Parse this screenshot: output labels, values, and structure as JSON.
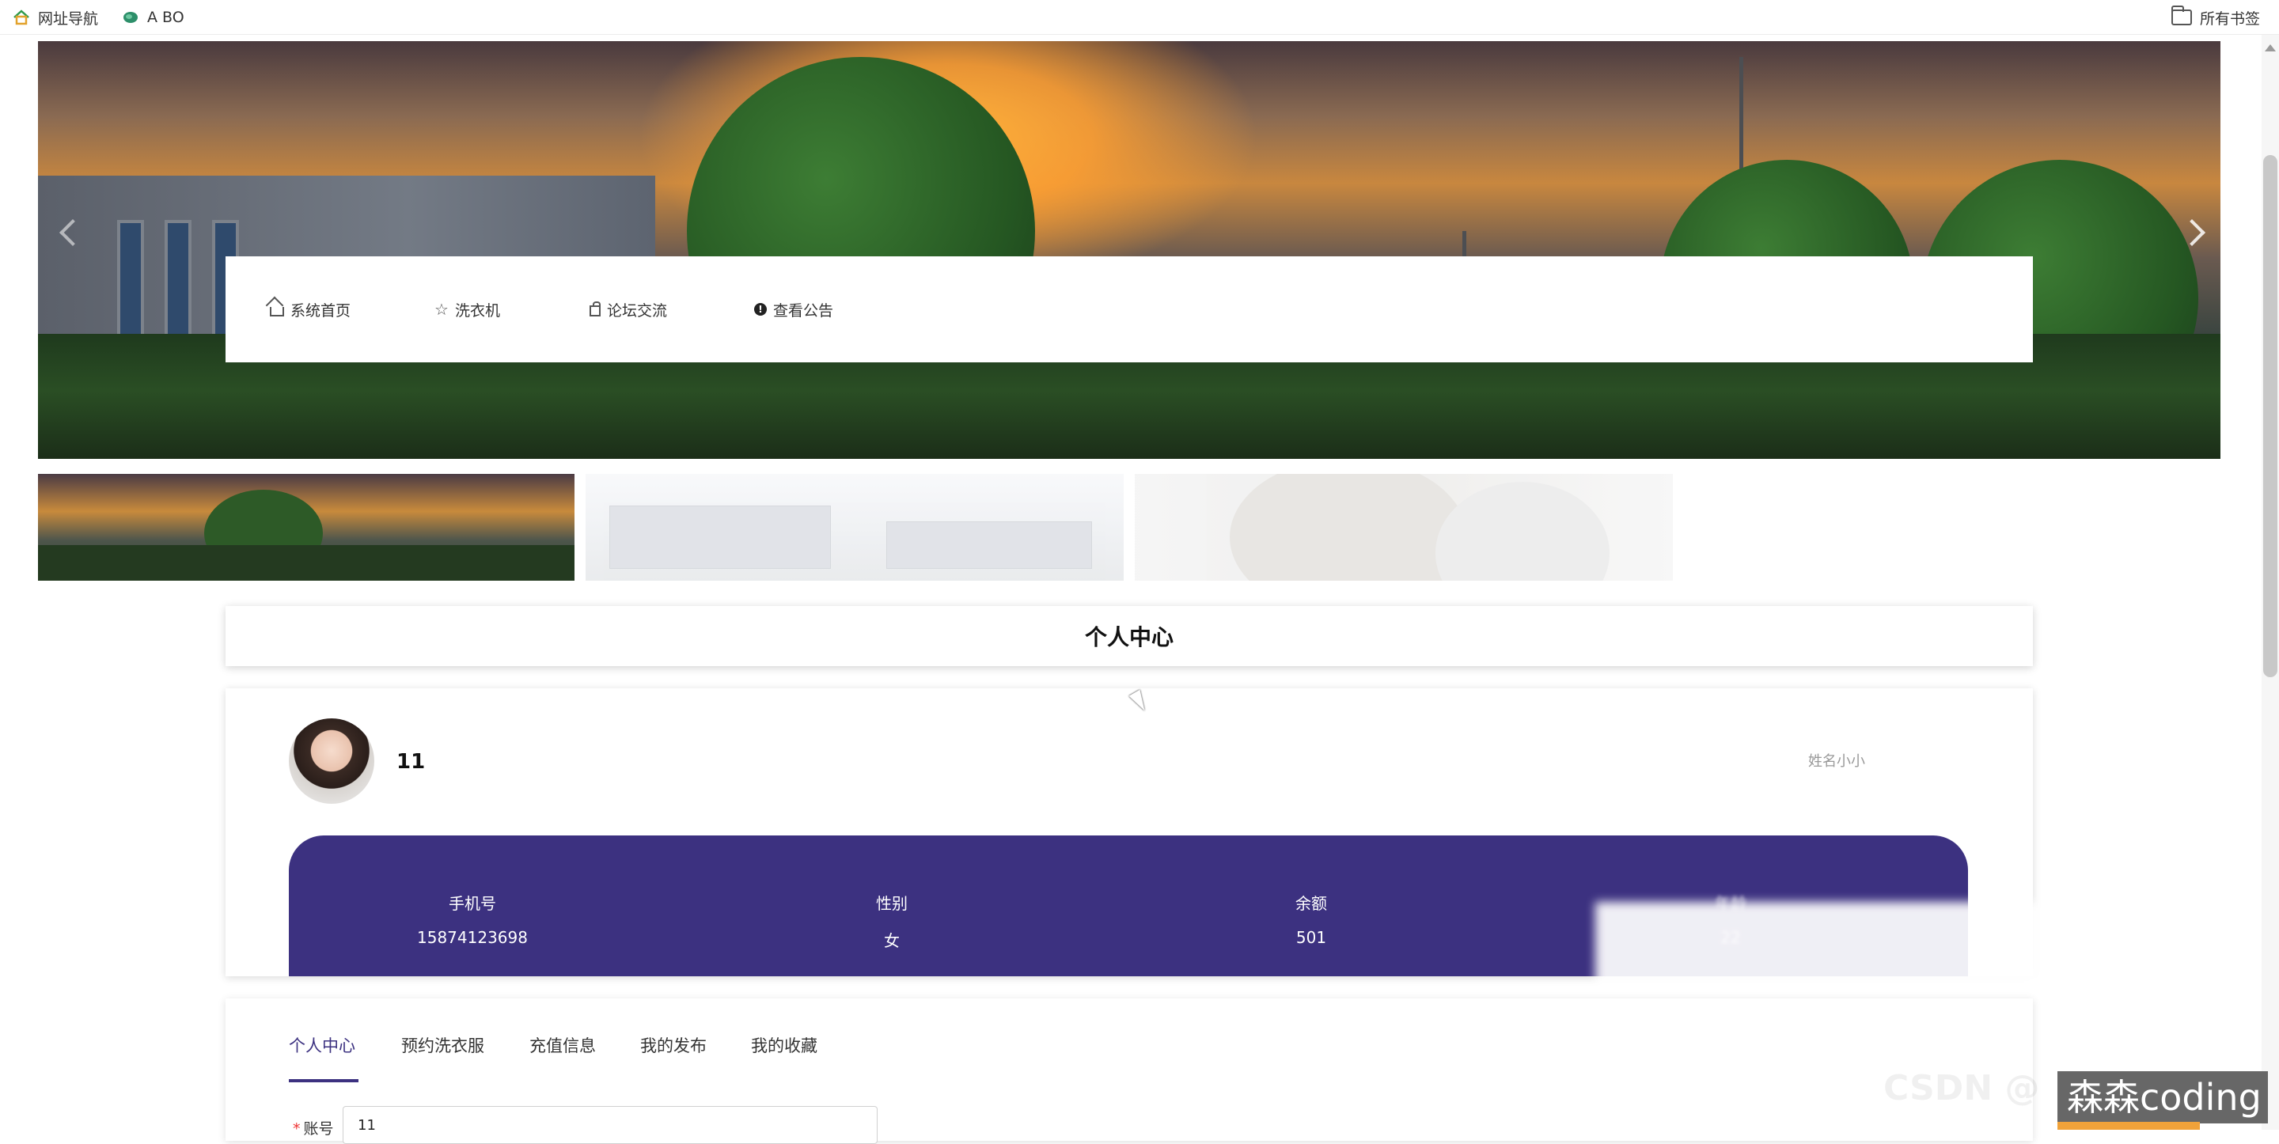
{
  "bookmarks": {
    "nav_label": "网址导航",
    "abo_label": "A BO",
    "all_label": "所有书签"
  },
  "nav": {
    "items": [
      {
        "label": "系统首页",
        "icon": "home-icon"
      },
      {
        "label": "洗衣机",
        "icon": "star-icon"
      },
      {
        "label": "论坛交流",
        "icon": "bag-icon"
      },
      {
        "label": "查看公告",
        "icon": "info-icon"
      }
    ]
  },
  "carousel": {
    "slide_count": 3,
    "active_index": 0
  },
  "page": {
    "title": "个人中心"
  },
  "profile": {
    "username": "11",
    "right_label": "姓名小小",
    "stats": [
      {
        "label": "手机号",
        "value": "15874123698"
      },
      {
        "label": "性别",
        "value": "女"
      },
      {
        "label": "余额",
        "value": "501"
      },
      {
        "label": "年龄",
        "value": "22"
      }
    ]
  },
  "tabs": {
    "items": [
      "个人中心",
      "预约洗衣服",
      "充值信息",
      "我的发布",
      "我的收藏"
    ],
    "active": 0
  },
  "form": {
    "account_label": "账号",
    "account_value": "11"
  },
  "watermark": {
    "text": "森森coding",
    "ghost": "CSDN @"
  },
  "colors": {
    "accent": "#3c3180",
    "nav_bg": "#ffffff",
    "page_bg": "#ffffff"
  }
}
